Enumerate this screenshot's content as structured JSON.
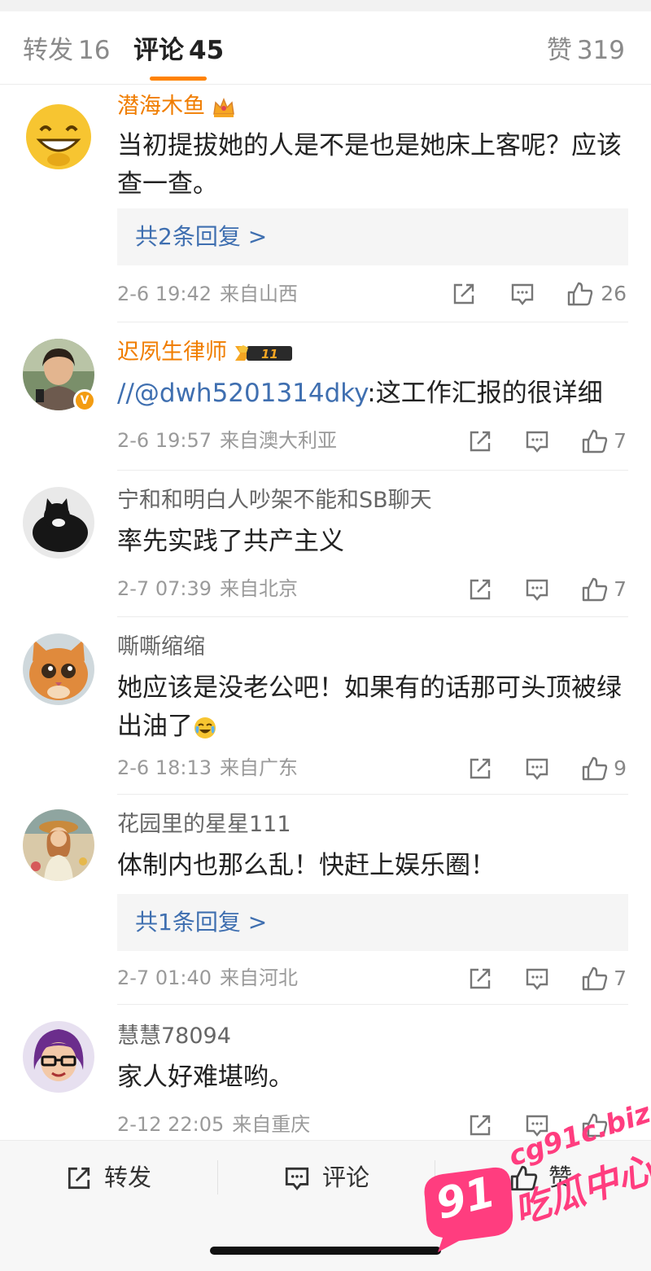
{
  "tabs": {
    "repost": {
      "label": "转发",
      "count": "16"
    },
    "comment": {
      "label": "评论",
      "count": "45"
    },
    "like": {
      "label": "赞",
      "count": "319"
    }
  },
  "comments": [
    {
      "username": "潜海木鱼",
      "text": "当初提拔她的人是不是也是她床上客呢？应该查一查。",
      "reply_link": "共2条回复 >",
      "date": "2-6 19:42",
      "location": "来自山西",
      "likes": "26",
      "avatar_icon": "grinning-emoji-icon"
    },
    {
      "username": "迟夙生律师",
      "level_badge": "11",
      "text_mention": "//@dwh5201314dky",
      "text": ":这工作汇报的很详细",
      "date": "2-6 19:57",
      "location": "来自澳大利亚",
      "likes": "7",
      "avatar_icon": "woman-portrait-icon"
    },
    {
      "username": "宁和和明白人吵架不能和SB聊天",
      "text": "率先实践了共产主义",
      "date": "2-7 07:39",
      "location": "来自北京",
      "likes": "7",
      "avatar_icon": "black-cat-icon"
    },
    {
      "username": "嘶嘶缩缩",
      "text": "她应该是没老公吧！如果有的话那可头顶被绿出油了",
      "date": "2-6 18:13",
      "location": "来自广东",
      "likes": "9",
      "avatar_icon": "orange-cat-icon"
    },
    {
      "username": "花园里的星星111",
      "text": "体制内也那么乱！快赶上娱乐圈！",
      "reply_link": "共1条回复 >",
      "date": "2-7 01:40",
      "location": "来自河北",
      "likes": "7",
      "avatar_icon": "girl-illustration-icon"
    },
    {
      "username": "慧慧78094",
      "text": "家人好难堪哟。",
      "date": "2-12 22:05",
      "location": "来自重庆",
      "likes": "",
      "avatar_icon": "cartoon-woman-glasses-icon"
    }
  ],
  "bottom_bar": {
    "repost_label": "转发",
    "comment_label": "评论",
    "like_label": "赞"
  },
  "watermark": {
    "site": "cg91c.biz",
    "name": "吃瓜中心",
    "number": "91"
  },
  "colors": {
    "accent": "#ff8200",
    "link": "#3f6fb0",
    "vip_name": "#f07d00",
    "watermark": "#ff3d7f"
  }
}
